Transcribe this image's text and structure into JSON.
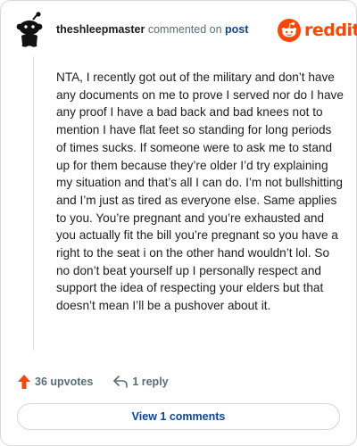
{
  "header": {
    "username": "theshleepmaster",
    "action_text": "commented on",
    "link_text": "post",
    "brand": "reddit"
  },
  "comment": {
    "body": "NTA, I recently got out of the military and don’t have any documents on me to prove I served nor do I have any proof I have a bad back and bad knees not to mention I have flat feet so standing for long periods of times sucks. If someone were to ask me to stand up for them because they’re older I’d try explaining my situation and that’s all I can do. I’m not bullshitting and I’m just as tired as everyone else. Same applies to you. You’re pregnant and you’re exhausted and you actually fit the bill you’re pregnant so you have a right to the seat i on the other hand wouldn’t lol. So no don’t beat yourself up I personally respect and support the idea of respecting your elders but that doesn’t mean I’ll be a pushover about it."
  },
  "actions": {
    "upvotes": "36 upvotes",
    "replies": "1 reply"
  },
  "footer": {
    "view_comments": "View 1 comments"
  },
  "icons": {
    "avatar": "snoo-avatar-icon",
    "logo": "reddit-logo-icon",
    "upvote": "upvote-arrow-icon",
    "reply": "reply-arrow-icon"
  },
  "colors": {
    "brand": "#ff4500",
    "link": "#0a449b",
    "muted": "#576f76"
  }
}
